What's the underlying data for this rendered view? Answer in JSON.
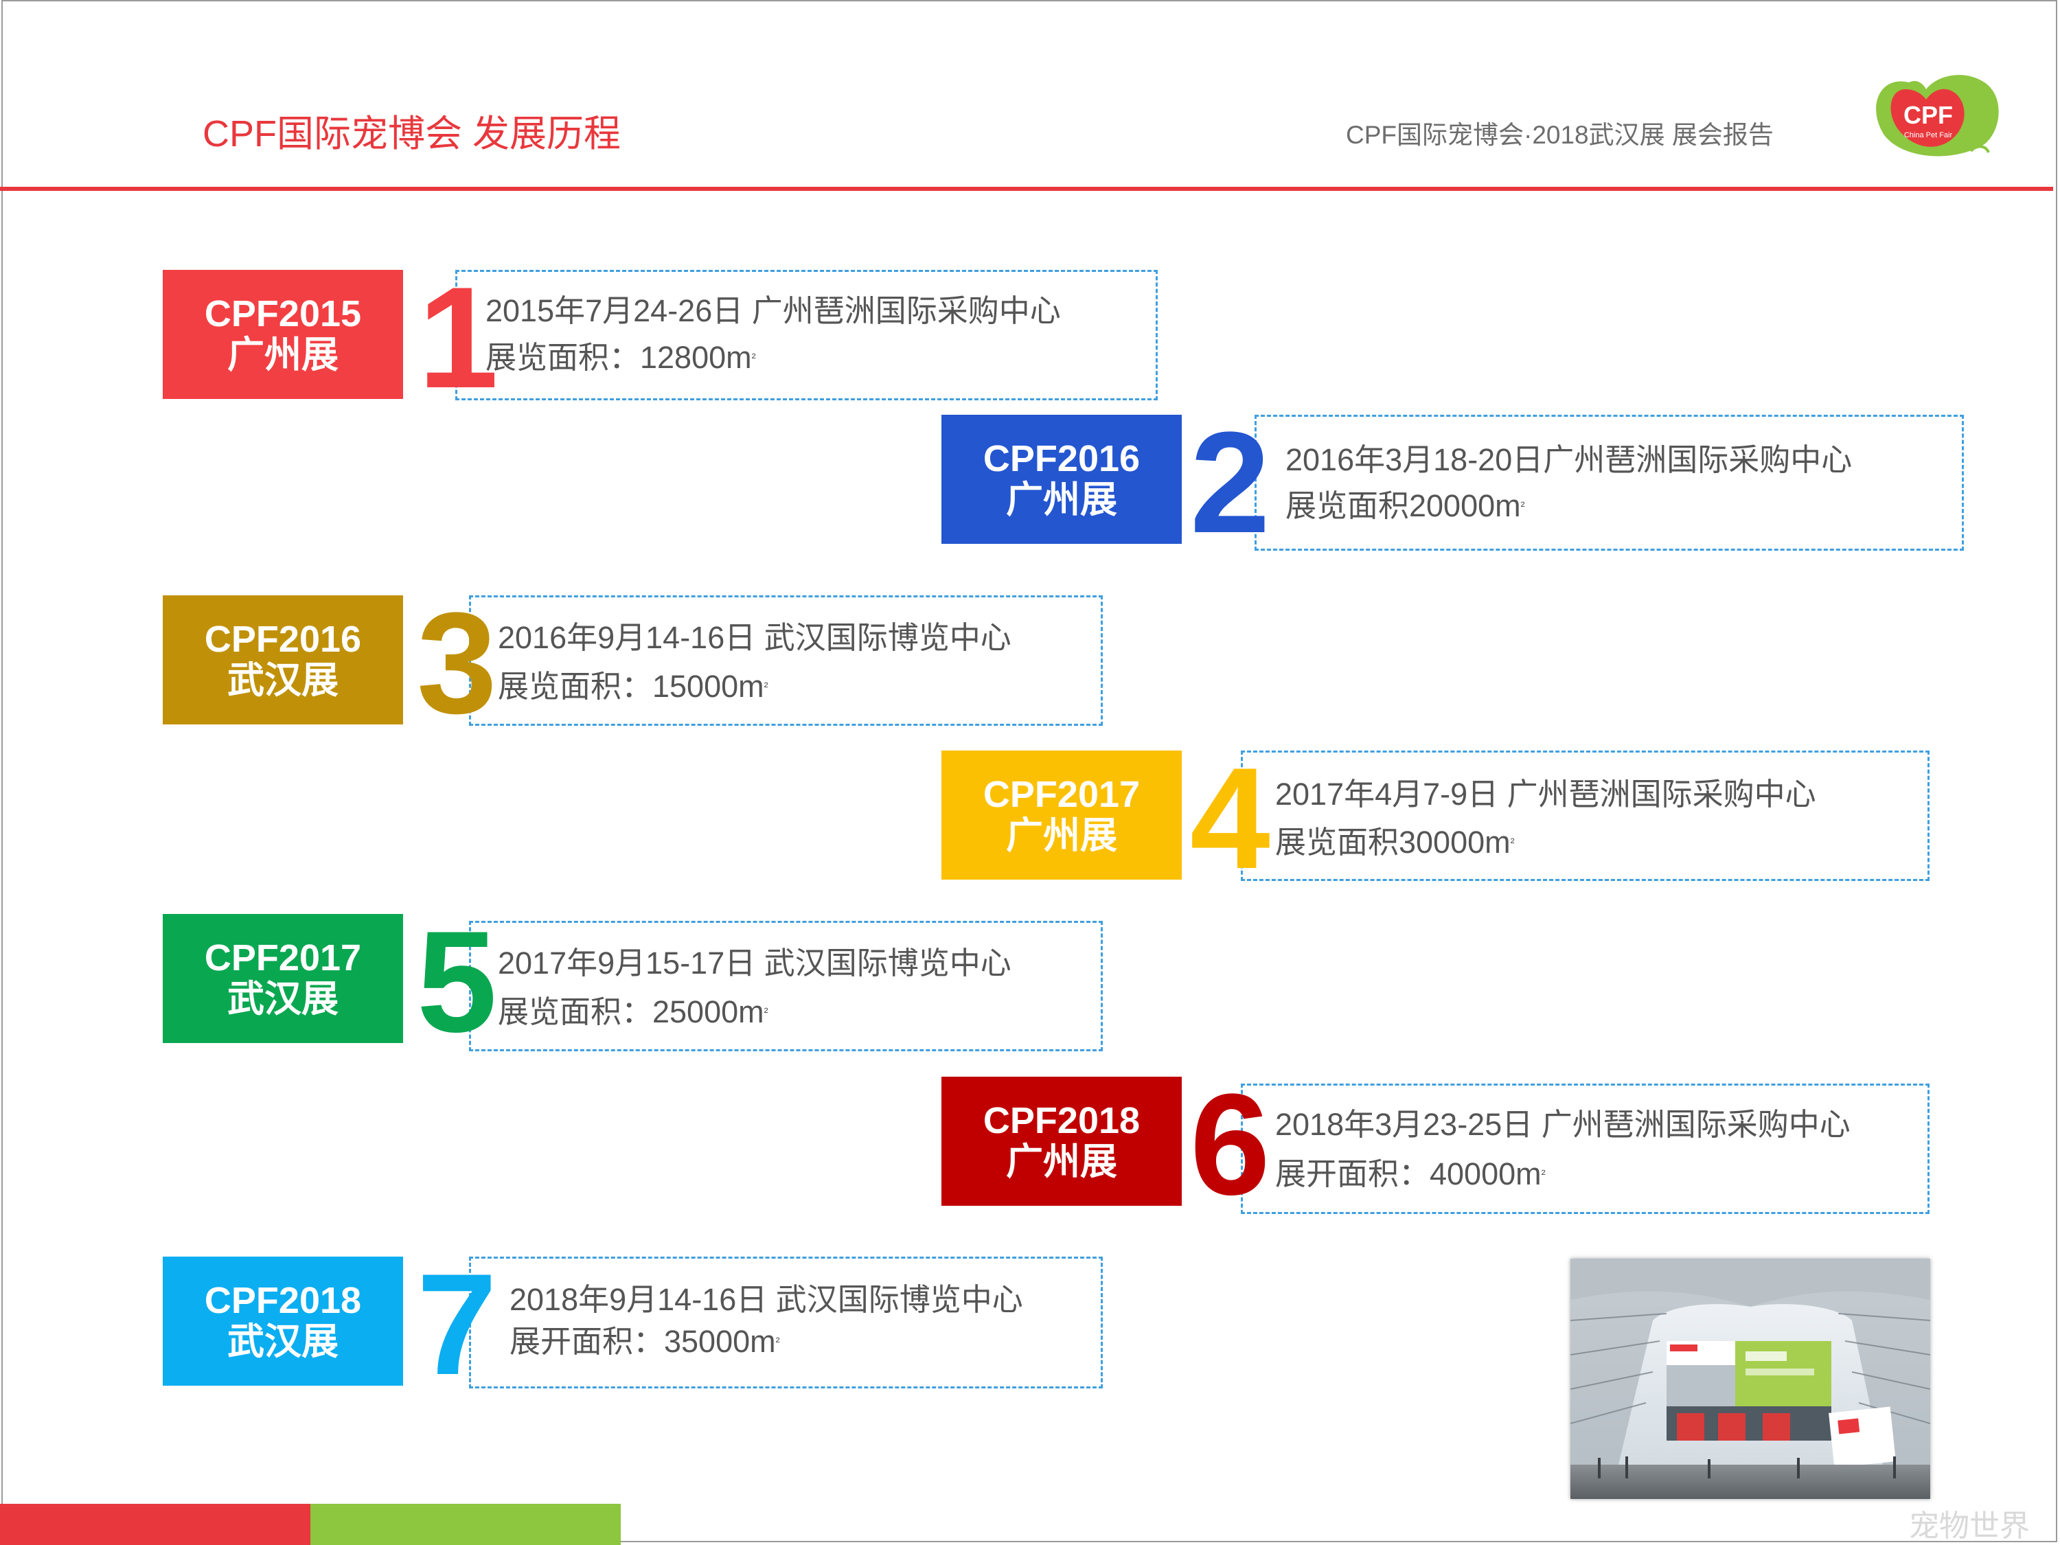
{
  "header": {
    "title": "CPF国际宠博会  发展历程",
    "report": "CPF国际宠博会·2018武汉展  展会报告",
    "logo_text": "CPF",
    "logo_sub": "China Pet Fair"
  },
  "colors": {
    "accent_red": "#e8383d",
    "accent_green": "#8dc63f",
    "dashed_border": "#3f9fe0"
  },
  "timeline": [
    {
      "label_line1": "CPF2015",
      "label_line2": "广州展",
      "number": "1",
      "color": "#f23f43",
      "detail_line1": "2015年7月24-26日 广州琶洲国际采购中心",
      "detail_line2": "展览面积：12800m"
    },
    {
      "label_line1": "CPF2016",
      "label_line2": "广州展",
      "number": "2",
      "color": "#2456d0",
      "detail_line1": "2016年3月18-20日广州琶洲国际采购中心",
      "detail_line2": "展览面积20000m"
    },
    {
      "label_line1": "CPF2016",
      "label_line2": "武汉展",
      "number": "3",
      "color": "#c09108",
      "detail_line1": "2016年9月14-16日 武汉国际博览中心",
      "detail_line2": "展览面积：15000m"
    },
    {
      "label_line1": "CPF2017",
      "label_line2": "广州展",
      "number": "4",
      "color": "#fcc003",
      "detail_line1": "2017年4月7-9日 广州琶洲国际采购中心",
      "detail_line2": "展览面积30000m"
    },
    {
      "label_line1": "CPF2017",
      "label_line2": "武汉展",
      "number": "5",
      "color": "#0aa751",
      "detail_line1": "2017年9月15-17日 武汉国际博览中心",
      "detail_line2": "展览面积：25000m"
    },
    {
      "label_line1": "CPF2018",
      "label_line2": "广州展",
      "number": "6",
      "color": "#c00000",
      "detail_line1": "2018年3月23-25日 广州琶洲国际采购中心",
      "detail_line2": "展开面积：40000m"
    },
    {
      "label_line1": "CPF2018",
      "label_line2": "武汉展",
      "number": "7",
      "color": "#0baef0",
      "detail_line1": "2018年9月14-16日 武汉国际博览中心",
      "detail_line2": "展开面积：35000m"
    }
  ],
  "area_unit_sup": "²",
  "watermark": "宠物世界"
}
